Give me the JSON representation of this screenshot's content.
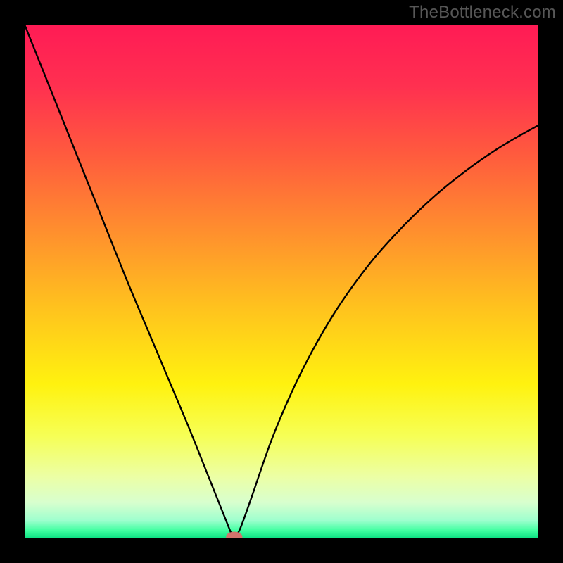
{
  "watermark": "TheBottleneck.com",
  "chart_data": {
    "type": "line",
    "title": "",
    "xlabel": "",
    "ylabel": "",
    "xlim": [
      0,
      100
    ],
    "ylim": [
      0,
      100
    ],
    "grid": false,
    "legend": false,
    "series": [
      {
        "name": "curve",
        "x": [
          0,
          4,
          8,
          12,
          16,
          20,
          24,
          28,
          32,
          36,
          38,
          40,
          40.5,
          41,
          42,
          44,
          48,
          52,
          56,
          60,
          64,
          68,
          72,
          76,
          80,
          84,
          88,
          92,
          96,
          100
        ],
        "y": [
          100,
          90,
          80,
          70,
          60,
          50,
          40.5,
          31,
          21.5,
          11.5,
          6.5,
          1.5,
          0.3,
          0.3,
          2,
          7.5,
          19,
          28.5,
          36.5,
          43.4,
          49.3,
          54.5,
          59,
          63.1,
          66.8,
          70.1,
          73.1,
          75.8,
          78.2,
          80.4
        ]
      }
    ],
    "marker": {
      "x": 40.8,
      "y": 0.3,
      "rx": 1.6,
      "ry": 1.0,
      "color": "#d1736c"
    },
    "background_gradient": {
      "stops": [
        {
          "offset": 0.0,
          "color": "#ff1b55"
        },
        {
          "offset": 0.12,
          "color": "#ff3050"
        },
        {
          "offset": 0.25,
          "color": "#ff5a3e"
        },
        {
          "offset": 0.4,
          "color": "#ff8e2e"
        },
        {
          "offset": 0.55,
          "color": "#ffc21e"
        },
        {
          "offset": 0.7,
          "color": "#fff20f"
        },
        {
          "offset": 0.8,
          "color": "#f6ff55"
        },
        {
          "offset": 0.88,
          "color": "#ecffa5"
        },
        {
          "offset": 0.93,
          "color": "#d8ffce"
        },
        {
          "offset": 0.965,
          "color": "#9effce"
        },
        {
          "offset": 0.985,
          "color": "#3fffa0"
        },
        {
          "offset": 1.0,
          "color": "#0be082"
        }
      ]
    }
  }
}
